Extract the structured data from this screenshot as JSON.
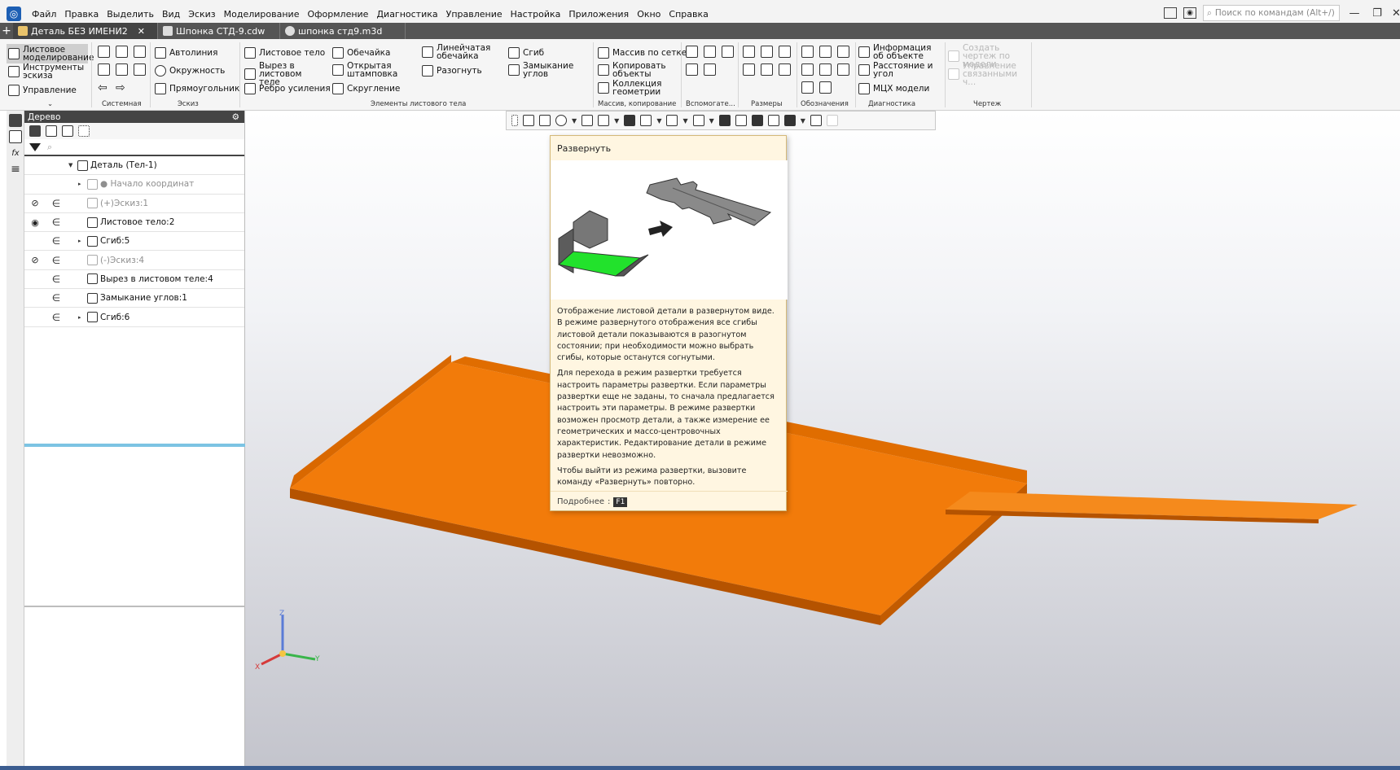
{
  "menubar": {
    "items": [
      "Файл",
      "Правка",
      "Выделить",
      "Вид",
      "Эскиз",
      "Моделирование",
      "Оформление",
      "Диагностика",
      "Управление",
      "Настройка",
      "Приложения",
      "Окно",
      "Справка"
    ],
    "search_placeholder": "Поиск по командам (Alt+/)"
  },
  "tabs": [
    {
      "label": "Деталь БЕЗ ИМЕНИ2",
      "close": "✕"
    },
    {
      "label": "Шпонка СТД-9.cdw"
    },
    {
      "label": "шпонка стд9.m3d"
    }
  ],
  "ribbon": {
    "mode": {
      "sheet_modeling": "Листовое моделирование",
      "sketch_tools": "Инструменты эскиза",
      "management": "Управление"
    },
    "sketch": {
      "autoline": "Автолиния",
      "circle": "Окружность",
      "rectangle": "Прямоугольник"
    },
    "sheet_body": {
      "sheet_body": "Листовое тело",
      "cut_in_sheet": "Вырез в листовом теле",
      "stiffener": "Ребро усиления",
      "shell": "Обечайка",
      "open_stamping": "Открытая штамповка",
      "rounding": "Скругление",
      "linear_shell": "Линейчатая обечайка",
      "unbend": "Разогнуть",
      "bend": "Сгиб",
      "corner_closure": "Замыкание углов"
    },
    "arrays": {
      "grid_array": "Массив по сетке",
      "copy_objects": "Копировать объекты",
      "geometry_collection": "Коллекция геометрии"
    },
    "diagnostics": {
      "object_info": "Информация об объекте",
      "distance_angle": "Расстояние и угол",
      "mass_properties": "МЦХ модели"
    },
    "drawing": {
      "create_drawing": "Создать чертеж по модели",
      "manage_linked": "Управление связанными ч..."
    },
    "group_labels": {
      "system": "Системная",
      "sketch": "Эскиз",
      "sheet_elements": "Элементы листового тела",
      "arrays": "Массив, копирование",
      "auxiliary": "Вспомогате...",
      "dimensions": "Размеры",
      "annotations": "Обозначения",
      "diagnostics": "Диагностика",
      "drawing": "Чертеж"
    }
  },
  "tree": {
    "title": "Дерево",
    "rows": [
      {
        "label": "Деталь (Тел-1)",
        "vis": "",
        "rel": "",
        "indent": 0,
        "caret": "▼",
        "dim": false
      },
      {
        "label": "● Начало координат",
        "vis": "",
        "rel": "",
        "indent": 1,
        "caret": "▸",
        "dim": true
      },
      {
        "label": "(+)Эскиз:1",
        "vis": "hidden",
        "rel": "∈",
        "indent": 1,
        "caret": "",
        "dim": true
      },
      {
        "label": "Листовое тело:2",
        "vis": "visible",
        "rel": "∈",
        "indent": 1,
        "caret": "",
        "dim": false
      },
      {
        "label": "Сгиб:5",
        "vis": "",
        "rel": "∈",
        "indent": 1,
        "caret": "▸",
        "dim": false
      },
      {
        "label": "(-)Эскиз:4",
        "vis": "hidden",
        "rel": "∈",
        "indent": 1,
        "caret": "",
        "dim": true
      },
      {
        "label": "Вырез в листовом теле:4",
        "vis": "",
        "rel": "∈",
        "indent": 1,
        "caret": "",
        "dim": false
      },
      {
        "label": "Замыкание углов:1",
        "vis": "",
        "rel": "∈",
        "indent": 1,
        "caret": "",
        "dim": false
      },
      {
        "label": "Сгиб:6",
        "vis": "",
        "rel": "∈",
        "indent": 1,
        "caret": "▸",
        "dim": false
      }
    ]
  },
  "tooltip": {
    "title": "Развернуть",
    "p1": "Отображение листовой детали в развернутом виде. В режиме развернутого отображения все сгибы листовой детали показываются в разогнутом состоянии; при необходимости можно выбрать сгибы, которые останутся согнутыми.",
    "p2": "Для перехода в режим развертки требуется настроить параметры развертки. Если параметры развертки еще не заданы, то сначала предлагается настроить эти параметры. В режиме развертки возможен просмотр детали, а также измерение ее геометрических и массо-центровочных характеристик. Редактирование детали в режиме развертки невозможно.",
    "p3": "Чтобы выйти из режима развертки, вызовите команду «Развернуть» повторно.",
    "more": "Подробнее",
    "key": "F1"
  },
  "axes": {
    "x": "X",
    "y": "Y",
    "z": "Z"
  },
  "colors": {
    "part": "#f07800",
    "part_shadow": "#c85f00",
    "accent_blue": "#7cc4e3"
  }
}
